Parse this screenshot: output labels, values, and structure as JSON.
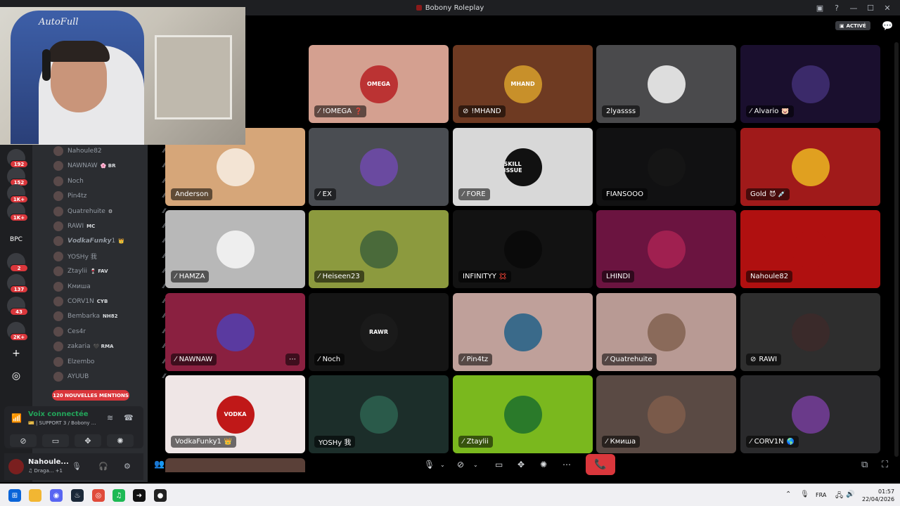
{
  "window": {
    "title": "Bobony Roleplay",
    "controls": [
      "—",
      "☐",
      "✕"
    ]
  },
  "header": {
    "active_badge": "ACTIVÉ"
  },
  "guilds": [
    {
      "badge": "192",
      "label": ""
    },
    {
      "badge": "152",
      "label": ""
    },
    {
      "badge": "1K+",
      "label": ""
    },
    {
      "badge": "1K+",
      "label": ""
    },
    {
      "badge": "",
      "label": "BPC"
    },
    {
      "badge": "2",
      "label": ""
    },
    {
      "badge": "137",
      "label": ""
    },
    {
      "badge": "43",
      "label": ""
    },
    {
      "badge": "2K+",
      "label": ""
    }
  ],
  "members": [
    {
      "name": "Nahoule82",
      "tag": ""
    },
    {
      "name": "NAWNAW",
      "tag": "🌸 BR"
    },
    {
      "name": "Noch",
      "tag": ""
    },
    {
      "name": "Pin4tz",
      "tag": ""
    },
    {
      "name": "Quatrehuite",
      "tag": "⚙"
    },
    {
      "name": "RAWI",
      "tag": "MC"
    },
    {
      "name": "𝙑𝙤𝙙𝙠𝙖𝙁𝙪𝙣𝙠𝙮1",
      "tag": "👑"
    },
    {
      "name": "YOSHy 我",
      "tag": ""
    },
    {
      "name": "Ztaylii",
      "tag": "🍷 FAV"
    },
    {
      "name": "Кмиша",
      "tag": ""
    },
    {
      "name": "CORV1N",
      "tag": "CYB"
    },
    {
      "name": "Bembarka",
      "tag": "NH82"
    },
    {
      "name": "Ces4r",
      "tag": ""
    },
    {
      "name": "zakaria",
      "tag": "🖤 RMA"
    },
    {
      "name": "Elzembo",
      "tag": ""
    },
    {
      "name": "AYUUB",
      "tag": ""
    }
  ],
  "mentions_pill": "120 NOUVELLES MENTIONS",
  "voice": {
    "status": "Voix connectée",
    "channel": "🎫 | SUPPORT 3 / Bobony ..."
  },
  "user": {
    "name": "Nahoule...",
    "status": "♫ Draga... +1"
  },
  "tiles": [
    {
      "name": "!OMEGA",
      "emoji": "❓",
      "muted": true,
      "bg": "#d4a090",
      "avatar_bg": "#b33",
      "avatar_text": "OMEGA"
    },
    {
      "name": "!MHAND",
      "emoji": "",
      "muted": true,
      "deaf": true,
      "bg": "#6e3a22",
      "avatar_bg": "#c8902a",
      "avatar_text": "MHAND"
    },
    {
      "name": "2lyassss",
      "emoji": "",
      "muted": false,
      "bg": "#4a4a4c",
      "avatar_bg": "#ddd",
      "avatar_text": ""
    },
    {
      "name": "Alvario",
      "emoji": "🐷",
      "muted": true,
      "bg": "#1a0f2e",
      "avatar_bg": "#3b2a6a",
      "avatar_text": ""
    },
    {
      "name": "Anderson",
      "emoji": "",
      "muted": false,
      "bg": "#d6a679",
      "avatar_bg": "#f3e4d4",
      "avatar_text": ""
    },
    {
      "name": "EX",
      "emoji": "",
      "muted": true,
      "bg": "#4a4d52",
      "avatar_bg": "#6a4aa0",
      "avatar_text": ""
    },
    {
      "name": "FORE",
      "emoji": "",
      "muted": true,
      "bg": "#d8d8d8",
      "avatar_bg": "#111",
      "avatar_text": "SKILL ISSUE"
    },
    {
      "name": "FIANSOOO",
      "emoji": "",
      "muted": false,
      "bg": "#111112",
      "avatar_bg": "#151515",
      "avatar_text": ""
    },
    {
      "name": "Gold",
      "emoji": "😈 💉",
      "muted": false,
      "bg": "#a01a1a",
      "avatar_bg": "#e0a020",
      "avatar_text": ""
    },
    {
      "name": "HAMZA",
      "emoji": "",
      "muted": true,
      "bg": "#b8b8b8",
      "avatar_bg": "#eee",
      "avatar_text": ""
    },
    {
      "name": "Heiseen23",
      "emoji": "",
      "muted": true,
      "bg": "#8c9a3e",
      "avatar_bg": "#4a6a3a",
      "avatar_text": ""
    },
    {
      "name": "INFINITYY",
      "emoji": "💢",
      "muted": false,
      "bg": "#121212",
      "avatar_bg": "#0a0a0a",
      "avatar_text": ""
    },
    {
      "name": "LHINDI",
      "emoji": "",
      "muted": false,
      "bg": "#6b1440",
      "avatar_bg": "#a02050",
      "avatar_text": ""
    },
    {
      "name": "Nahoule82",
      "emoji": "",
      "muted": false,
      "bg": "#b01010",
      "avatar_bg": "#b01010",
      "avatar_text": ""
    },
    {
      "name": "NAWNAW",
      "emoji": "",
      "muted": true,
      "bg": "#8a2040",
      "avatar_bg": "#5a3aa0",
      "avatar_text": "",
      "more": "⋯"
    },
    {
      "name": "Noch",
      "emoji": "",
      "muted": true,
      "bg": "#151515",
      "avatar_bg": "#1a1a1a",
      "avatar_text": "RAWR"
    },
    {
      "name": "Pin4tz",
      "emoji": "",
      "muted": true,
      "bg": "#bfa09a",
      "avatar_bg": "#3a6a8a",
      "avatar_text": ""
    },
    {
      "name": "Quatrehuite",
      "emoji": "",
      "muted": true,
      "bg": "#b89a94",
      "avatar_bg": "#8a6a5a",
      "avatar_text": ""
    },
    {
      "name": "RAWI",
      "emoji": "",
      "muted": true,
      "deaf": true,
      "bg": "#2e2e2e",
      "avatar_bg": "#3a2a2a",
      "avatar_text": ""
    },
    {
      "name": "VodkaFunky1",
      "emoji": "👑",
      "muted": false,
      "bg": "#efe6e6",
      "avatar_bg": "#c01818",
      "avatar_text": "VODKA"
    },
    {
      "name": "YOSHy 我",
      "emoji": "",
      "muted": false,
      "bg": "#1c2e2a",
      "avatar_bg": "#2a5a4a",
      "avatar_text": ""
    },
    {
      "name": "Ztaylii",
      "emoji": "",
      "muted": true,
      "bg": "#7ab81e",
      "avatar_bg": "#2a7a2a",
      "avatar_text": ""
    },
    {
      "name": "Кмиша",
      "emoji": "",
      "muted": true,
      "bg": "#5a4a44",
      "avatar_bg": "#7a5a4a",
      "avatar_text": ""
    },
    {
      "name": "CORV1N",
      "emoji": "🌎",
      "muted": true,
      "bg": "#2a2a2c",
      "avatar_bg": "#6a3a8a",
      "avatar_text": ""
    }
  ],
  "callbar": {
    "hangup_icon": "📞"
  },
  "taskbar": {
    "lang": "FRA",
    "time": "01:57",
    "date": "22/04/2026"
  },
  "colors": {
    "accent_red": "#da373c",
    "voice_green": "#23a55a"
  }
}
